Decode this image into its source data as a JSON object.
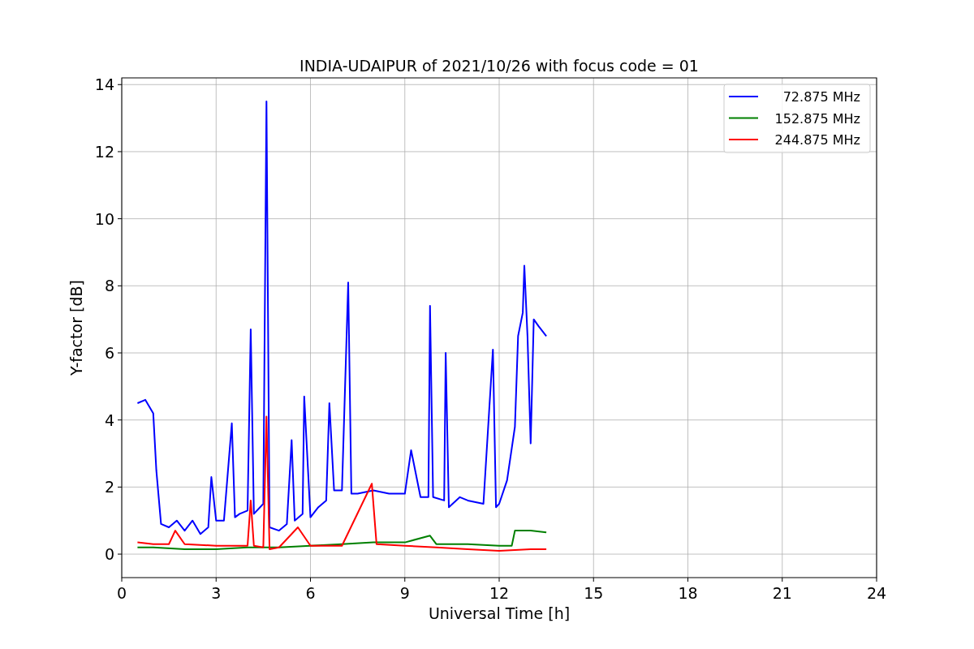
{
  "chart_data": {
    "type": "line",
    "title": "INDIA-UDAIPUR of 2021/10/26 with focus code = 01",
    "xlabel": "Universal Time [h]",
    "ylabel": "Y-factor [dB]",
    "xlim": [
      0,
      24
    ],
    "ylim": [
      -0.7,
      14.2
    ],
    "xticks": [
      0,
      3,
      6,
      9,
      12,
      15,
      18,
      21,
      24
    ],
    "yticks": [
      0,
      2,
      4,
      6,
      8,
      10,
      12,
      14
    ],
    "grid": true,
    "legend": true,
    "series": [
      {
        "name": "72.875 MHz",
        "color": "#0000ff",
        "x": [
          0.5,
          0.75,
          1.0,
          1.1,
          1.25,
          1.5,
          1.75,
          2.0,
          2.25,
          2.5,
          2.75,
          2.85,
          3.0,
          3.25,
          3.5,
          3.6,
          3.75,
          4.0,
          4.1,
          4.2,
          4.5,
          4.6,
          4.7,
          5.0,
          5.25,
          5.4,
          5.5,
          5.75,
          5.8,
          6.0,
          6.25,
          6.5,
          6.6,
          6.75,
          7.0,
          7.2,
          7.3,
          7.5,
          8.0,
          8.5,
          9.0,
          9.2,
          9.5,
          9.75,
          9.8,
          9.9,
          10.25,
          10.3,
          10.4,
          10.75,
          11.0,
          11.5,
          11.8,
          11.9,
          12.0,
          12.25,
          12.5,
          12.6,
          12.75,
          12.8,
          12.9,
          13.0,
          13.1,
          13.25,
          13.5
        ],
        "values": [
          4.5,
          4.6,
          4.2,
          2.5,
          0.9,
          0.8,
          1.0,
          0.7,
          1.0,
          0.6,
          0.8,
          2.3,
          1.0,
          1.0,
          3.9,
          1.1,
          1.2,
          1.3,
          6.7,
          1.2,
          1.5,
          13.5,
          0.8,
          0.7,
          0.9,
          3.4,
          1.0,
          1.2,
          4.7,
          1.1,
          1.4,
          1.6,
          4.5,
          1.9,
          1.9,
          8.1,
          1.8,
          1.8,
          1.9,
          1.8,
          1.8,
          3.1,
          1.7,
          1.7,
          7.4,
          1.7,
          1.6,
          6.0,
          1.4,
          1.7,
          1.6,
          1.5,
          6.1,
          1.4,
          1.5,
          2.2,
          3.8,
          6.5,
          7.2,
          8.6,
          6.5,
          3.3,
          7.0,
          6.8,
          6.5
        ]
      },
      {
        "name": "152.875 MHz",
        "color": "#008000",
        "x": [
          0.5,
          1,
          2,
          3,
          4,
          5,
          6,
          7,
          8,
          9,
          9.8,
          10,
          11,
          12,
          12.4,
          12.5,
          13,
          13.5
        ],
        "values": [
          0.2,
          0.2,
          0.15,
          0.15,
          0.2,
          0.2,
          0.25,
          0.3,
          0.35,
          0.35,
          0.55,
          0.3,
          0.3,
          0.25,
          0.25,
          0.7,
          0.7,
          0.65
        ]
      },
      {
        "name": "244.875 MHz",
        "color": "#ff0000",
        "x": [
          0.5,
          1,
          1.5,
          1.7,
          2,
          3,
          4,
          4.1,
          4.2,
          4.5,
          4.6,
          4.7,
          5,
          5.6,
          6,
          7,
          7.95,
          8.1,
          9,
          10,
          11,
          12,
          13,
          13.5
        ],
        "values": [
          0.35,
          0.3,
          0.3,
          0.7,
          0.3,
          0.25,
          0.25,
          1.6,
          0.25,
          0.2,
          4.1,
          0.15,
          0.2,
          0.8,
          0.25,
          0.25,
          2.1,
          0.3,
          0.25,
          0.2,
          0.15,
          0.1,
          0.15,
          0.15
        ]
      }
    ]
  }
}
